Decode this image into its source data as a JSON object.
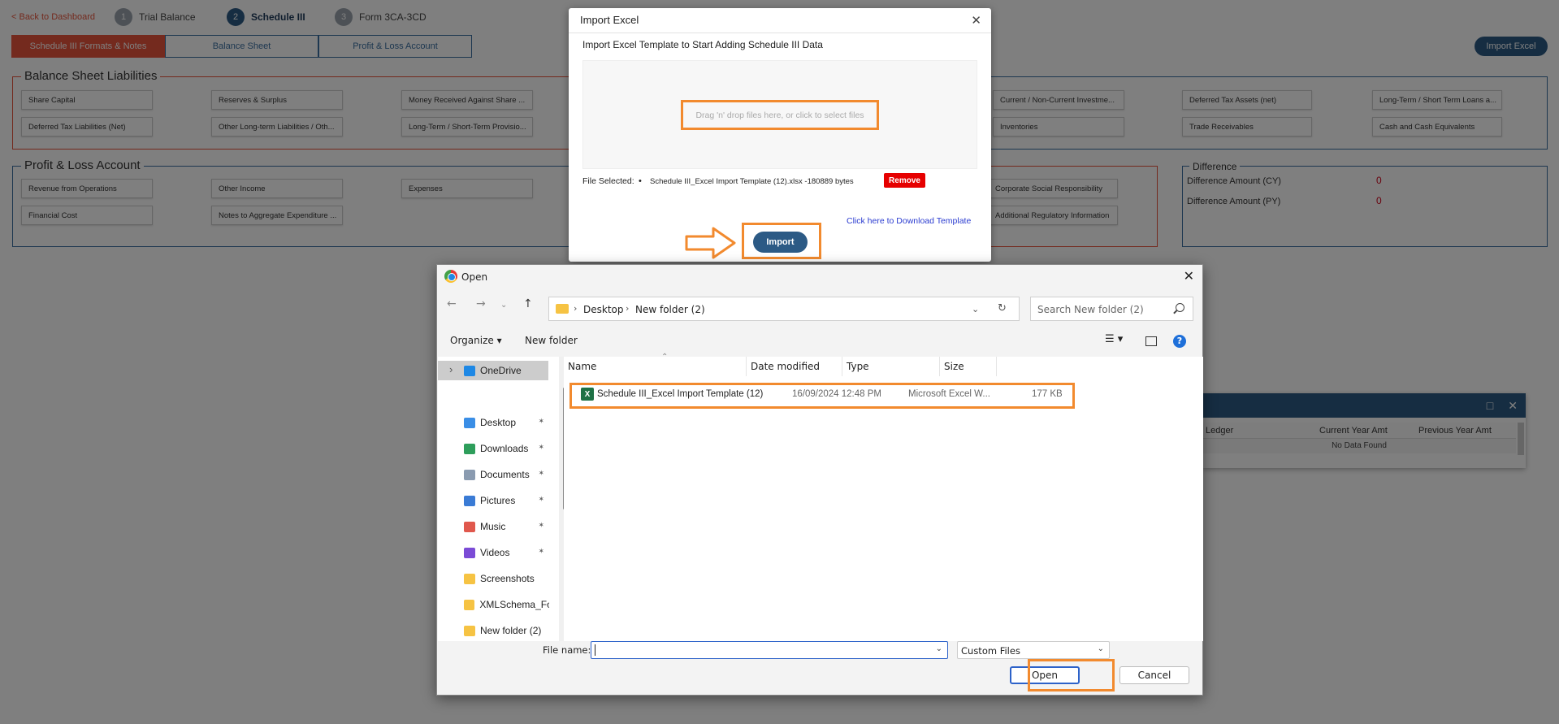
{
  "header": {
    "back_label": "< Back to Dashboard",
    "steps": [
      {
        "num": "1",
        "label": "Trial Balance"
      },
      {
        "num": "2",
        "label": "Schedule III"
      },
      {
        "num": "3",
        "label": "Form 3CA-3CD"
      }
    ],
    "tabs": [
      "Schedule III Formats & Notes",
      "Balance Sheet",
      "Profit & Loss Account"
    ],
    "import_excel_label": "Import Excel"
  },
  "balance_sheet_liabilities": {
    "title": "Balance Sheet Liabilities",
    "items": [
      "Share Capital",
      "Reserves & Surplus",
      "Money Received Against Share ...",
      "Deferred Tax Liabilities (Net)",
      "Other Long-term Liabilities / Oth...",
      "Long-Term / Short-Term Provisio..."
    ]
  },
  "balance_sheet_assets": {
    "items": [
      "Current / Non-Current Investme...",
      "Deferred Tax Assets (net)",
      "Long-Term / Short Term Loans a...",
      "Inventories",
      "Trade Receivables",
      "Cash and Cash Equivalents"
    ]
  },
  "profit_loss": {
    "title": "Profit & Loss Account",
    "items": [
      "Revenue from Operations",
      "Other Income",
      "Expenses",
      "Financial Cost",
      "Notes to Aggregate Expenditure ..."
    ]
  },
  "other_items": [
    "Corporate Social Responsibility",
    "Additional Regulatory Information"
  ],
  "difference": {
    "title": "Difference",
    "cy_label": "Difference Amount (CY)",
    "cy_value": "0",
    "py_label": "Difference Amount (PY)",
    "py_value": "0"
  },
  "side_panel": {
    "columns": [
      "Ledger",
      "Current Year Amt",
      "Previous Year Amt"
    ],
    "empty_text": "No Data Found"
  },
  "import_modal": {
    "title": "Import Excel",
    "subtitle": "Import Excel Template to Start Adding Schedule III Data",
    "drop_text": "Drag 'n' drop files here, or click to select files",
    "file_selected_label": "File Selected:",
    "file_name": "Schedule III_Excel Import Template (12).xlsx -180889 bytes",
    "remove_label": "Remove",
    "download_label": "Click here to Download Template",
    "import_label": "Import"
  },
  "open_dialog": {
    "title": "Open",
    "breadcrumb": [
      "Desktop",
      "New folder (2)"
    ],
    "search_placeholder": "Search New folder (2)",
    "organize_label": "Organize",
    "new_folder_label": "New folder",
    "nav_items": [
      {
        "label": "OneDrive",
        "icon": "cloud-icon",
        "color": "#1e88e5"
      },
      {
        "label": "Desktop",
        "icon": "desktop-icon",
        "color": "#3a8ee6"
      },
      {
        "label": "Downloads",
        "icon": "download-icon",
        "color": "#2e9e5b"
      },
      {
        "label": "Documents",
        "icon": "document-icon",
        "color": "#8a9bb0"
      },
      {
        "label": "Pictures",
        "icon": "picture-icon",
        "color": "#3a7bd5"
      },
      {
        "label": "Music",
        "icon": "music-icon",
        "color": "#e0584d"
      },
      {
        "label": "Videos",
        "icon": "video-icon",
        "color": "#7b4bd6"
      },
      {
        "label": "Screenshots",
        "icon": "folder-icon",
        "color": "#f6c343"
      },
      {
        "label": "XMLSchema_Fo",
        "icon": "folder-icon",
        "color": "#f6c343"
      },
      {
        "label": "New folder (2)",
        "icon": "folder-icon",
        "color": "#f6c343"
      }
    ],
    "columns": [
      "Name",
      "Date modified",
      "Type",
      "Size"
    ],
    "files": [
      {
        "name": "Schedule III_Excel Import Template (12)",
        "date": "16/09/2024 12:48 PM",
        "type": "Microsoft Excel W...",
        "size": "177 KB"
      }
    ],
    "file_name_label": "File name:",
    "file_name_value": "",
    "file_type": "Custom Files",
    "open_label": "Open",
    "cancel_label": "Cancel"
  },
  "colors": {
    "accent_orange": "#e8553c",
    "brand_blue": "#2c5a85",
    "highlight": "#f28a2e",
    "remove_red": "#e60000"
  }
}
